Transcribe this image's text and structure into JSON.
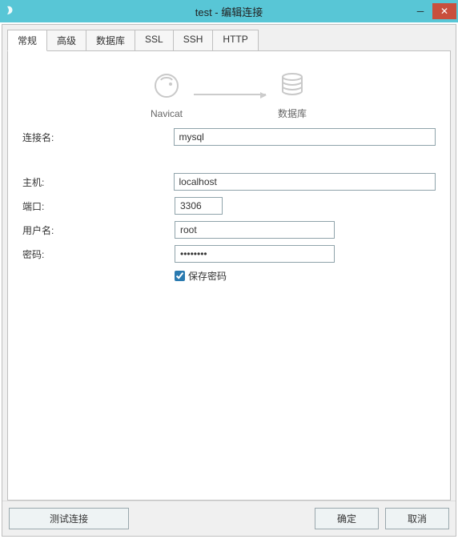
{
  "window": {
    "title": "test - 编辑连接"
  },
  "tabs": {
    "t0": "常规",
    "t1": "高级",
    "t2": "数据库",
    "t3": "SSL",
    "t4": "SSH",
    "t5": "HTTP"
  },
  "illus": {
    "left_label": "Navicat",
    "right_label": "数据库"
  },
  "labels": {
    "conn_name": "连接名:",
    "host": "主机:",
    "port": "端口:",
    "user": "用户名:",
    "password": "密码:",
    "save_password": "保存密码"
  },
  "values": {
    "conn_name": "mysql",
    "host": "localhost",
    "port": "3306",
    "user": "root",
    "password": "••••••••"
  },
  "buttons": {
    "test": "测试连接",
    "ok": "确定",
    "cancel": "取消"
  }
}
